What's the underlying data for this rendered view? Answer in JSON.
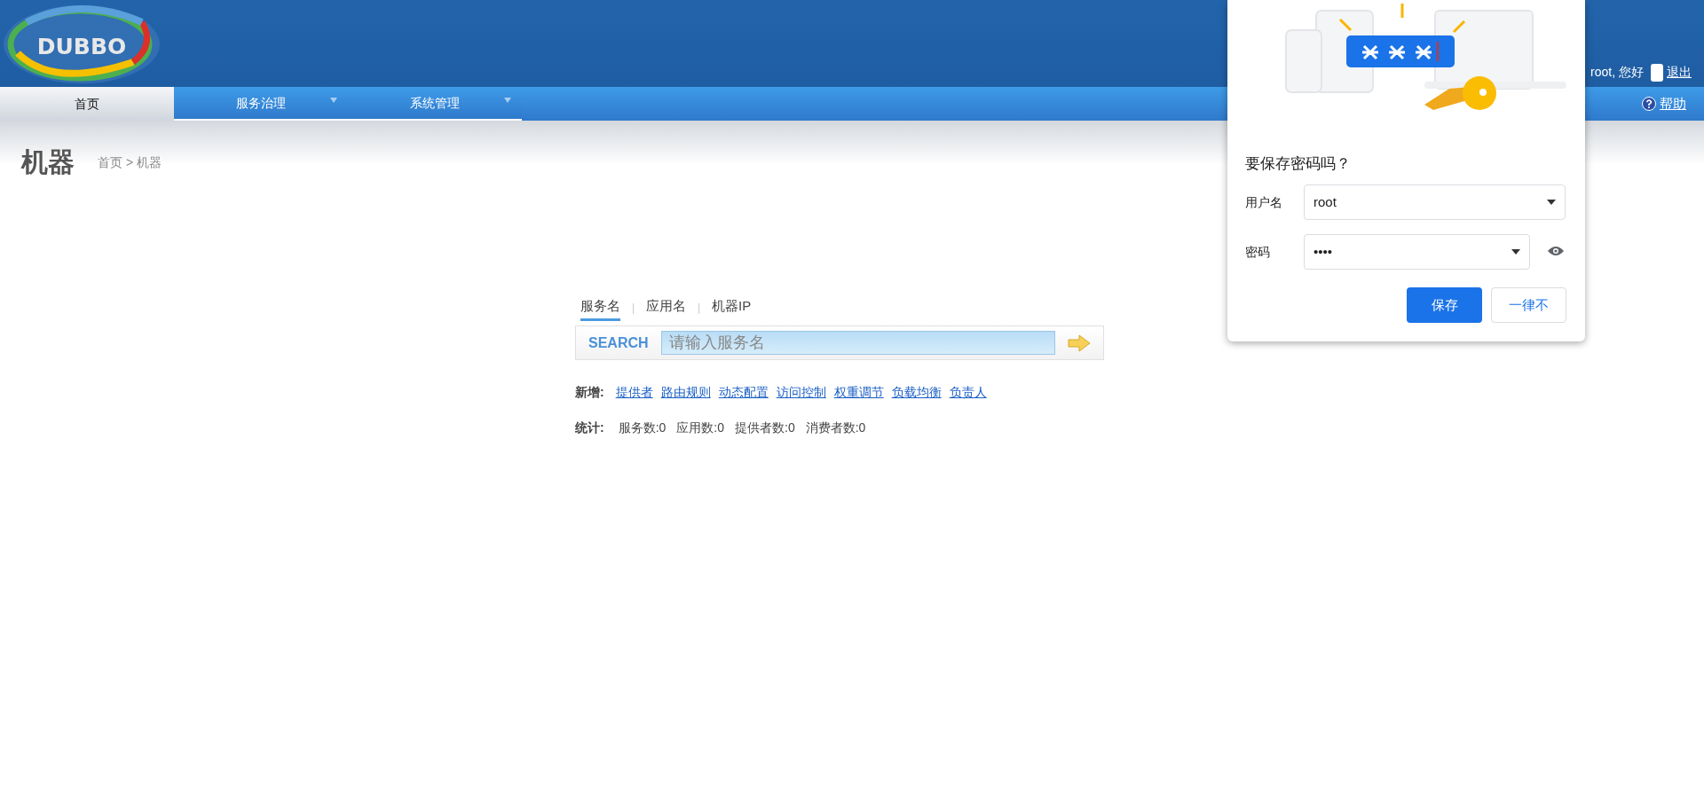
{
  "header": {
    "logo_text": "DUBBO",
    "user_greeting": "root, 您好",
    "logout_link": "退出",
    "help_link": "帮助"
  },
  "nav": [
    {
      "label": "首页",
      "selected": true,
      "has_dropdown": false
    },
    {
      "label": "服务治理",
      "selected": false,
      "has_dropdown": true
    },
    {
      "label": "系统管理",
      "selected": false,
      "has_dropdown": true
    }
  ],
  "page_title": "机器",
  "breadcrumb": "首页 > 机器",
  "search": {
    "tabs": [
      {
        "label": "服务名",
        "selected": true
      },
      {
        "label": "应用名",
        "selected": false
      },
      {
        "label": "机器IP",
        "selected": false
      }
    ],
    "button_label": "SEARCH",
    "placeholder": "请输入服务名"
  },
  "add": {
    "label": "新增:",
    "links": [
      "提供者",
      "路由规则",
      "动态配置",
      "访问控制",
      "权重调节",
      "负载均衡",
      "负责人"
    ]
  },
  "stats": {
    "label": "统计:",
    "items": [
      "服务数:0",
      "应用数:0",
      "提供者数:0",
      "消费者数:0"
    ]
  },
  "password_dialog": {
    "title": "要保存密码吗？",
    "username_label": "用户名",
    "username": "root",
    "password_label": "密码",
    "password": "••••",
    "save_button": "保存",
    "never_button": "一律不"
  }
}
